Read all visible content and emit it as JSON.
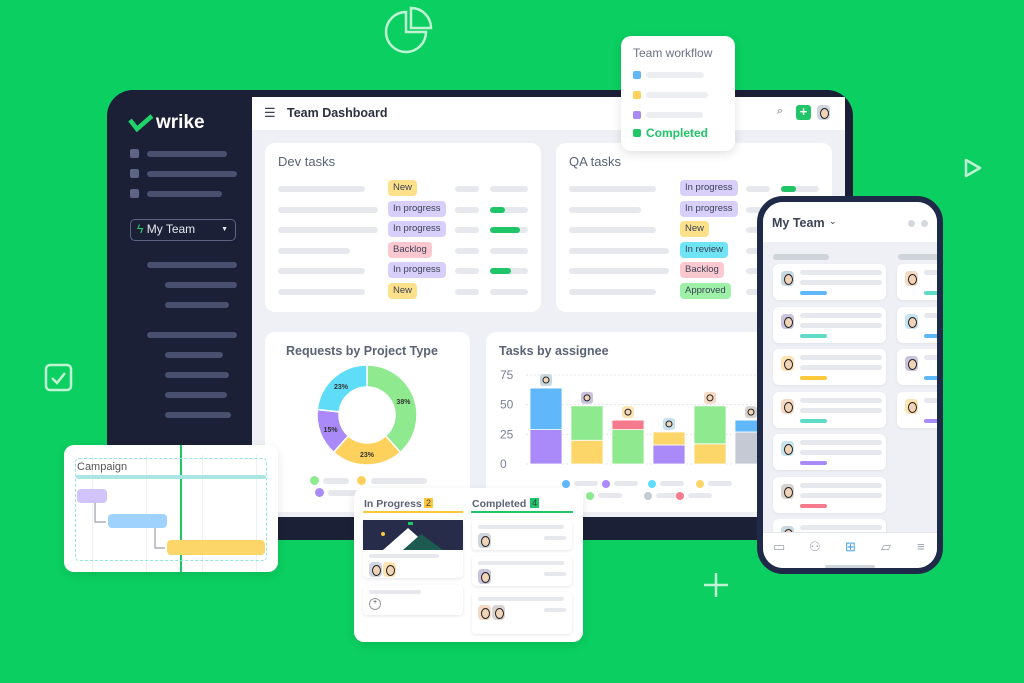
{
  "brand": {
    "logo_text": "wrike",
    "accent": "#0bcf61"
  },
  "header": {
    "title": "Team Dashboard",
    "menu_icon": "hamburger-icon",
    "search_icon": "search-icon",
    "add_icon": "plus-icon"
  },
  "sidebar": {
    "team_selector": "My Team",
    "team_icon": "bolt-icon"
  },
  "dev_tasks": {
    "title": "Dev tasks",
    "rows": [
      {
        "status": "New",
        "color": "#fde08a",
        "progress": 0
      },
      {
        "status": "In progress",
        "color": "#d8cffb",
        "progress": 0.4
      },
      {
        "status": "In progress",
        "color": "#d8cffb",
        "progress": 0.8
      },
      {
        "status": "Backlog",
        "color": "#fbc8d0",
        "progress": 0
      },
      {
        "status": "In progress",
        "color": "#d8cffb",
        "progress": 0.55
      },
      {
        "status": "New",
        "color": "#fde08a",
        "progress": 0
      }
    ]
  },
  "qa_tasks": {
    "title": "QA tasks",
    "rows": [
      {
        "status": "In progress",
        "color": "#d8cffb",
        "progress": 0.4
      },
      {
        "status": "In progress",
        "color": "#d8cffb"
      },
      {
        "status": "New",
        "color": "#fde08a"
      },
      {
        "status": "In review",
        "color": "#6fe4f4"
      },
      {
        "status": "Backlog",
        "color": "#fbc8d0"
      },
      {
        "status": "Approved",
        "color": "#9ef0a6"
      }
    ]
  },
  "chart_data": [
    {
      "type": "pie",
      "title": "Requests by Project Type",
      "slices": [
        {
          "value": 38,
          "label": "38%",
          "color": "#8ee98f"
        },
        {
          "value": 23,
          "label": "23%",
          "color": "#fdd15b"
        },
        {
          "value": 15,
          "label": "15%",
          "color": "#a98af8"
        },
        {
          "value": 23,
          "label": "23%",
          "color": "#5fdcf8"
        }
      ]
    },
    {
      "type": "bar",
      "stacked": true,
      "title": "Tasks by assignee",
      "ylim": [
        0,
        75
      ],
      "yticks": [
        "0",
        "25",
        "50",
        "75"
      ],
      "bars": [
        [
          {
            "value": 29,
            "color": "#a98af8"
          },
          {
            "value": 35,
            "color": "#60b8fb"
          }
        ],
        [
          {
            "value": 20,
            "color": "#fdd66a"
          },
          {
            "value": 29,
            "color": "#8ee98f"
          }
        ],
        [
          {
            "value": 29,
            "color": "#8ee98f"
          },
          {
            "value": 8,
            "color": "#f47a8c"
          }
        ],
        [
          {
            "value": 16,
            "color": "#a98af8"
          },
          {
            "value": 11,
            "color": "#fdd66a"
          }
        ],
        [
          {
            "value": 17,
            "color": "#fdd66a"
          },
          {
            "value": 32,
            "color": "#8ee98f"
          }
        ],
        [
          {
            "value": 27,
            "color": "#c5c9d3"
          },
          {
            "value": 10,
            "color": "#60b8fb"
          }
        ]
      ]
    }
  ],
  "workflow_popup": {
    "title": "Team workflow",
    "items": [
      {
        "color": "#60b8fb"
      },
      {
        "color": "#fdd15b"
      },
      {
        "color": "#a98af8"
      }
    ],
    "completed_label": "Completed"
  },
  "gantt": {
    "label": "Campaign"
  },
  "kanban": {
    "columns": [
      {
        "title": "In Progress",
        "count": "2",
        "color": "#fdc93a"
      },
      {
        "title": "Completed",
        "count": "4",
        "color": "#1fc566"
      }
    ]
  },
  "mobile": {
    "title": "My Team",
    "nav_icons": [
      "inbox-icon",
      "team-icon",
      "board-icon",
      "folder-icon",
      "menu-icon"
    ]
  }
}
